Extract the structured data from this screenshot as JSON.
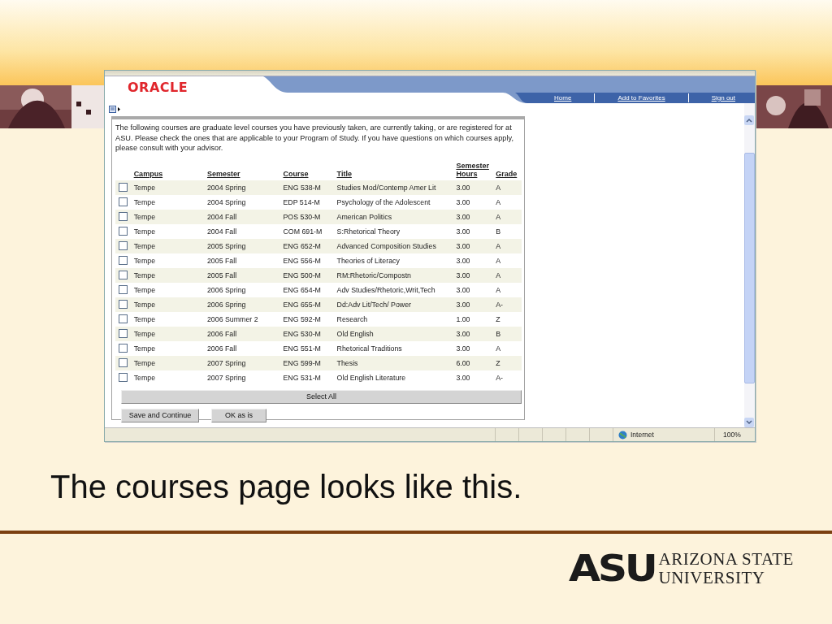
{
  "slide": {
    "caption": "The courses page looks like this.",
    "logo_mark": "ASU",
    "logo_lines": [
      "ARIZONA STATE",
      "UNIVERSITY"
    ]
  },
  "browser": {
    "logo": "ORACLE",
    "nav_links": [
      "Home",
      "Add to Favorites",
      "Sign out"
    ]
  },
  "intro": "The following courses are graduate level courses you have previously taken, are currently taking, or are registered for at ASU. Please check the ones that are applicable to your Program of Study. If you have questions on which courses apply, please consult with your advisor.",
  "table": {
    "columns": [
      "Campus",
      "Semester",
      "Course",
      "Title",
      "Semester Hours",
      "Grade"
    ],
    "rows": [
      {
        "checked": false,
        "cells": [
          "Tempe",
          "2004 Spring",
          "ENG 538-M",
          "Studies Mod/Contemp Amer Lit",
          "3.00",
          "A"
        ]
      },
      {
        "checked": false,
        "cells": [
          "Tempe",
          "2004 Spring",
          "EDP 514-M",
          "Psychology of the Adolescent",
          "3.00",
          "A"
        ]
      },
      {
        "checked": false,
        "cells": [
          "Tempe",
          "2004 Fall",
          "POS 530-M",
          "American Politics",
          "3.00",
          "A"
        ]
      },
      {
        "checked": false,
        "cells": [
          "Tempe",
          "2004 Fall",
          "COM 691-M",
          "S:Rhetorical Theory",
          "3.00",
          "B"
        ]
      },
      {
        "checked": false,
        "cells": [
          "Tempe",
          "2005 Spring",
          "ENG 652-M",
          "Advanced Composition Studies",
          "3.00",
          "A"
        ]
      },
      {
        "checked": false,
        "cells": [
          "Tempe",
          "2005 Fall",
          "ENG 556-M",
          "Theories of Literacy",
          "3.00",
          "A"
        ]
      },
      {
        "checked": false,
        "cells": [
          "Tempe",
          "2005 Fall",
          "ENG 500-M",
          "RM:Rhetoric/Compostn",
          "3.00",
          "A"
        ]
      },
      {
        "checked": false,
        "cells": [
          "Tempe",
          "2006 Spring",
          "ENG 654-M",
          "Adv Studies/Rhetoric,Writ,Tech",
          "3.00",
          "A"
        ]
      },
      {
        "checked": false,
        "cells": [
          "Tempe",
          "2006 Spring",
          "ENG 655-M",
          "Dd:Adv Lit/Tech/ Power",
          "3.00",
          "A-"
        ]
      },
      {
        "checked": false,
        "cells": [
          "Tempe",
          "2006 Summer 2",
          "ENG 592-M",
          "Research",
          "1.00",
          "Z"
        ]
      },
      {
        "checked": false,
        "cells": [
          "Tempe",
          "2006 Fall",
          "ENG 530-M",
          "Old English",
          "3.00",
          "B"
        ]
      },
      {
        "checked": false,
        "cells": [
          "Tempe",
          "2006 Fall",
          "ENG 551-M",
          "Rhetorical Traditions",
          "3.00",
          "A"
        ]
      },
      {
        "checked": false,
        "cells": [
          "Tempe",
          "2007 Spring",
          "ENG 599-M",
          "Thesis",
          "6.00",
          "Z"
        ]
      },
      {
        "checked": false,
        "cells": [
          "Tempe",
          "2007 Spring",
          "ENG 531-M",
          "Old English Literature",
          "3.00",
          "A-"
        ]
      }
    ]
  },
  "buttons": [
    "Select All",
    "Save and Continue",
    "OK as is"
  ],
  "status_bar": {
    "zone": "Internet",
    "zoom": "100%"
  }
}
